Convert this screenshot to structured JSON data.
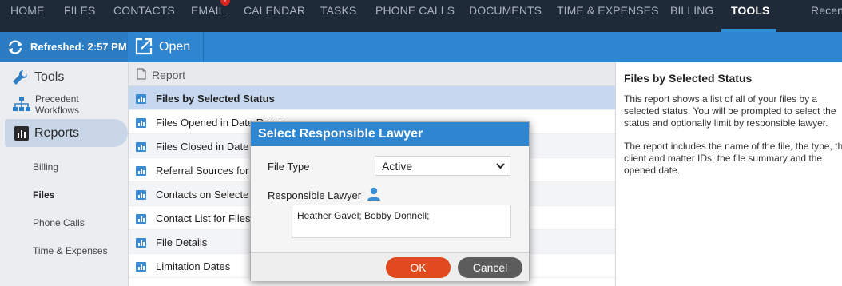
{
  "nav": {
    "items": [
      "HOME",
      "FILES",
      "CONTACTS",
      "EMAIL",
      "CALENDAR",
      "TASKS",
      "PHONE CALLS",
      "DOCUMENTS",
      "TIME & EXPENSES",
      "BILLING",
      "TOOLS",
      "Recen"
    ],
    "active": "TOOLS",
    "email_badge": "2"
  },
  "toolbar": {
    "refreshed_label": "Refreshed: 2:57 PM",
    "open_label": "Open"
  },
  "sidebar": {
    "tools_label": "Tools",
    "precedent_line1": "Precedent",
    "precedent_line2": "Workflows",
    "reports_label": "Reports",
    "sub_items": [
      "Billing",
      "Files",
      "Phone Calls",
      "Time & Expenses"
    ],
    "selected_sub": "Files"
  },
  "report_list": {
    "header": "Report",
    "rows": [
      "Files by Selected Status",
      "Files Opened in Date Range",
      "Files Closed in Date",
      "Referral Sources for",
      "Contacts on Selecte",
      "Contact List for Files",
      "File Details",
      "Limitation Dates"
    ],
    "selected_index": 0
  },
  "description": {
    "title": "Files by Selected Status",
    "para1": "This report shows a list of all of your files by a selected status. You will be prompted to select the status and optionally limit by responsible lawyer.",
    "para2": "The report includes the name of the file, the type, the client and matter IDs, the file summary and the opened date."
  },
  "modal": {
    "title": "Select Responsible Lawyer",
    "file_type_label": "File Type",
    "file_type_value": "Active",
    "responsible_lawyer_label": "Responsible Lawyer",
    "responsible_lawyer_value": "Heather Gavel; Bobby Donnell;",
    "ok_label": "OK",
    "cancel_label": "Cancel"
  },
  "colors": {
    "nav_bg": "#1e2a38",
    "accent": "#2f86d0",
    "ok": "#e04a1e",
    "cancel": "#5c5c5c"
  }
}
